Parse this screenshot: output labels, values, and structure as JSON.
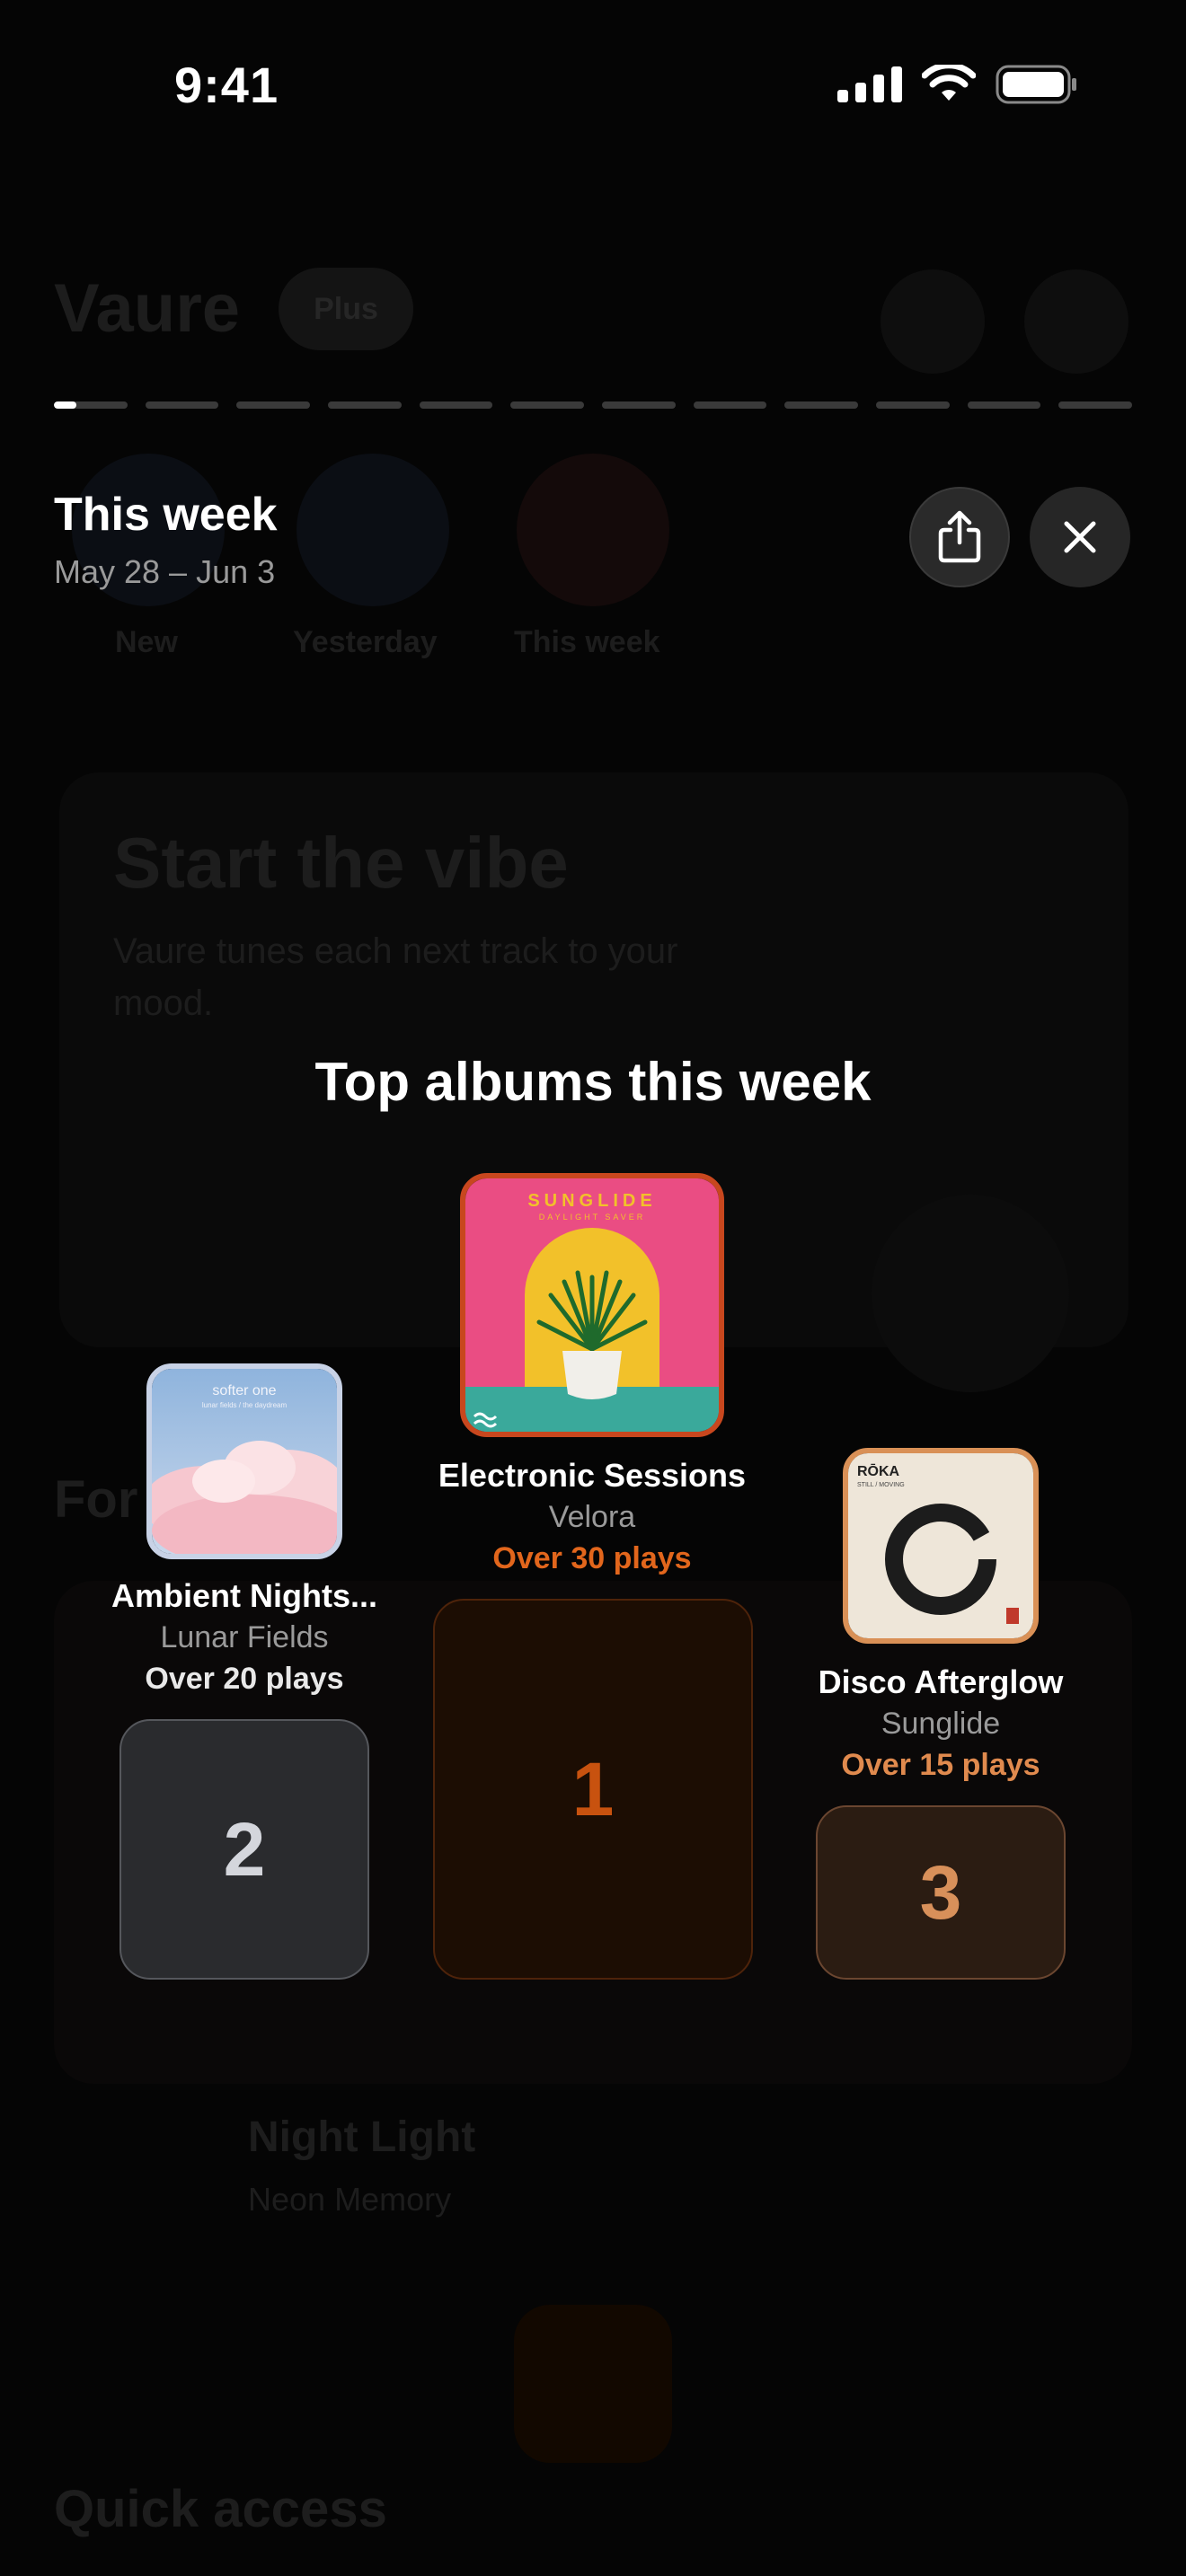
{
  "status_bar": {
    "time": "9:41"
  },
  "background_app": {
    "app_title": "Vaure",
    "plan_badge": "Plus",
    "circles": [
      "New",
      "Yesterday",
      "This week"
    ],
    "hero_title": "Start the vibe",
    "hero_text": "Vaure tunes each next track to your mood.",
    "section_for": "For",
    "now_playing_title": "Night Light",
    "now_playing_artist": "Neon Memory",
    "section_quick": "Quick access"
  },
  "story": {
    "segments_total": 12,
    "segments_current": 1,
    "current_progress": 0.3,
    "title": "This week",
    "date_range": "May 28 – Jun 3",
    "share_icon": "share-icon",
    "close_icon": "close-icon"
  },
  "top_albums": {
    "heading": "Top albums this week",
    "accent_color": "#E2661C",
    "albums": [
      {
        "rank": "1",
        "title": "Electronic Sessions",
        "artist": "Velora",
        "plays": "Over 30 plays",
        "cover_text": "SUNGLIDE",
        "cover_subtext": "DAYLIGHT SAVER",
        "plays_color": "#E2661C"
      },
      {
        "rank": "2",
        "title": "Ambient Nights...",
        "artist": "Lunar Fields",
        "plays": "Over 20 plays",
        "cover_text": "softer one",
        "cover_subtext": "lunar fields / the daydream",
        "plays_color": "#E8E8E8"
      },
      {
        "rank": "3",
        "title": "Disco Afterglow",
        "artist": "Sunglide",
        "plays": "Over 15 plays",
        "cover_text": "RŌKA",
        "cover_subtext": "STILL / MOVING",
        "plays_color": "#E08A4E"
      }
    ]
  }
}
